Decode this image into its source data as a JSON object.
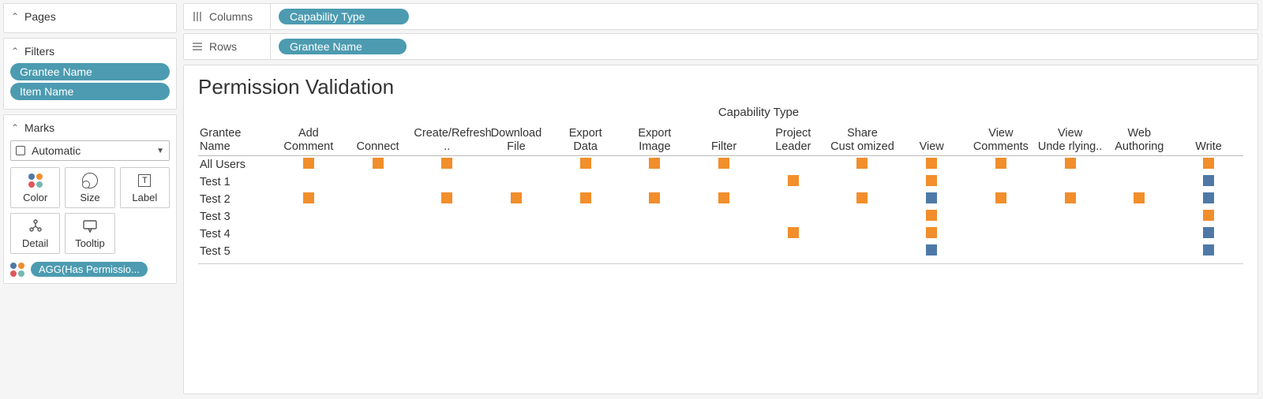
{
  "sidebar": {
    "pages_label": "Pages",
    "filters_label": "Filters",
    "filters": [
      "Grantee Name",
      "Item Name"
    ],
    "marks_label": "Marks",
    "mark_type": "Automatic",
    "mark_buttons": [
      "Color",
      "Size",
      "Label",
      "Detail",
      "Tooltip"
    ],
    "color_legend_pill": "AGG(Has Permissio..."
  },
  "shelves": {
    "columns_label": "Columns",
    "columns_pill": "Capability Type",
    "rows_label": "Rows",
    "rows_pill": "Grantee Name"
  },
  "viz": {
    "title": "Permission Validation",
    "col_axis_title": "Capability Type",
    "row_header": "Grantee Name",
    "columns": [
      "Add Comment",
      "Connect",
      "Create/Refresh ..",
      "Download File",
      "Export Data",
      "Export Image",
      "Filter",
      "Project Leader",
      "Share Cust omized",
      "View",
      "View Comments",
      "View Unde rlying..",
      "Web Authoring",
      "Write"
    ],
    "rows": [
      "All Users",
      "Test 1",
      "Test 2",
      "Test 3",
      "Test 4",
      "Test 5"
    ],
    "marks": {
      "All Users": {
        "Add Comment": "o",
        "Connect": "o",
        "Create/Refresh ..": "o",
        "Export Data": "o",
        "Export Image": "o",
        "Filter": "o",
        "Share Cust omized": "o",
        "View": "o",
        "View Comments": "o",
        "View Unde rlying..": "o",
        "Write": "o"
      },
      "Test 1": {
        "Project Leader": "o",
        "View": "o",
        "Write": "b"
      },
      "Test 2": {
        "Add Comment": "o",
        "Create/Refresh ..": "o",
        "Download File": "o",
        "Export Data": "o",
        "Export Image": "o",
        "Filter": "o",
        "Share Cust omized": "o",
        "View": "b",
        "View Comments": "o",
        "View Unde rlying..": "o",
        "Web Authoring": "o",
        "Write": "b"
      },
      "Test 3": {
        "View": "o",
        "Write": "o"
      },
      "Test 4": {
        "Project Leader": "o",
        "View": "o",
        "Write": "b"
      },
      "Test 5": {
        "View": "b",
        "Write": "b"
      }
    }
  },
  "chart_data": {
    "type": "heatmap",
    "title": "Permission Validation",
    "xlabel": "Capability Type",
    "ylabel": "Grantee Name",
    "x": [
      "Add Comment",
      "Connect",
      "Create/Refresh ..",
      "Download File",
      "Export Data",
      "Export Image",
      "Filter",
      "Project Leader",
      "Share Cust omized",
      "View",
      "View Comments",
      "View Unde rlying..",
      "Web Authoring",
      "Write"
    ],
    "y": [
      "All Users",
      "Test 1",
      "Test 2",
      "Test 3",
      "Test 4",
      "Test 5"
    ],
    "legend_field": "AGG(Has Permission)",
    "color_map": {
      "o": "orange",
      "b": "blue",
      "": "none"
    },
    "values": [
      [
        "o",
        "o",
        "o",
        "",
        "o",
        "o",
        "o",
        "",
        "o",
        "o",
        "o",
        "o",
        "",
        "o"
      ],
      [
        "",
        "",
        "",
        "",
        "",
        "",
        "",
        "o",
        "",
        "o",
        "",
        "",
        "",
        "b"
      ],
      [
        "o",
        "",
        "o",
        "o",
        "o",
        "o",
        "o",
        "",
        "o",
        "b",
        "o",
        "o",
        "o",
        "b"
      ],
      [
        "",
        "",
        "",
        "",
        "",
        "",
        "",
        "",
        "",
        "o",
        "",
        "",
        "",
        "o"
      ],
      [
        "",
        "",
        "",
        "",
        "",
        "",
        "",
        "o",
        "",
        "o",
        "",
        "",
        "",
        "b"
      ],
      [
        "",
        "",
        "",
        "",
        "",
        "",
        "",
        "",
        "",
        "b",
        "",
        "",
        "",
        "b"
      ]
    ]
  }
}
